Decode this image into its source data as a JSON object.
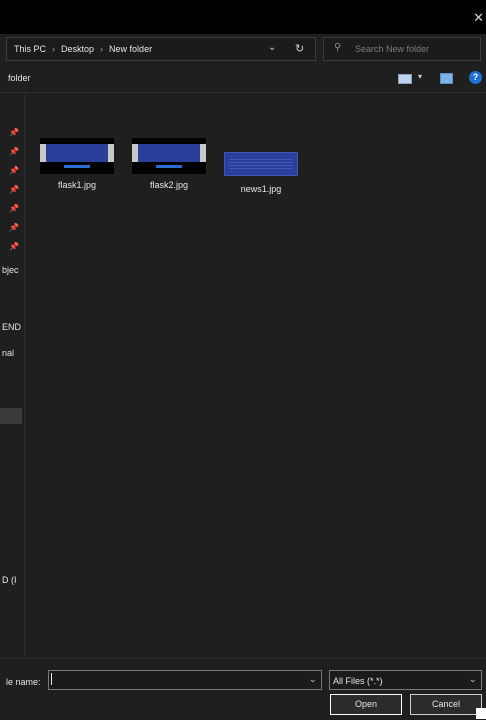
{
  "window": {
    "close_glyph": "✕"
  },
  "address": {
    "crumbs": [
      "This PC",
      "Desktop",
      "New folder"
    ],
    "separator": "›",
    "chevron_glyph": "⌄",
    "refresh_glyph": "↻"
  },
  "search": {
    "placeholder": "Search New folder",
    "icon_glyph": "⚲"
  },
  "toolbar": {
    "folder_label": "folder",
    "view_drop_glyph": "▾",
    "help_glyph": "?"
  },
  "navpane": {
    "pin_glyph": "📌",
    "labels": [
      "bjec",
      "END",
      "nal",
      "D (I"
    ]
  },
  "files": [
    {
      "name": "flask1.jpg"
    },
    {
      "name": "flask2.jpg"
    },
    {
      "name": "news1.jpg"
    }
  ],
  "footer": {
    "file_name_label": "le name:",
    "file_name_value": "",
    "filter_value": "All Files (*.*)",
    "dropdown_glyph": "⌄",
    "open_label": "Open",
    "cancel_label": "Cancel"
  },
  "colors": {
    "background": "#1f1f1f",
    "titlebar": "#000000",
    "accent": "#1e6fd6"
  }
}
